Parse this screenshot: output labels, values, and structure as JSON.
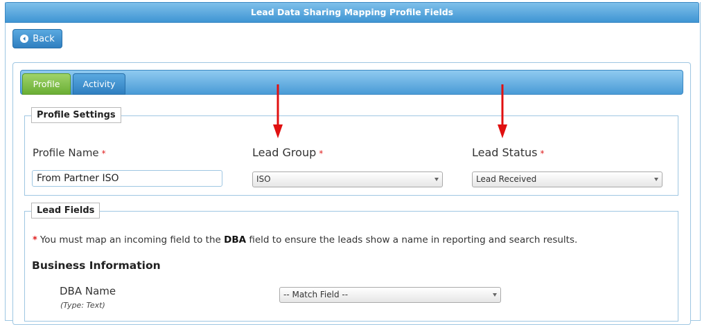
{
  "window": {
    "title": "Lead Data Sharing Mapping Profile Fields"
  },
  "toolbar": {
    "back_label": "Back"
  },
  "tabs": [
    {
      "label": "Profile",
      "active": true
    },
    {
      "label": "Activity",
      "active": false
    }
  ],
  "profile_settings": {
    "legend": "Profile Settings",
    "profile_name": {
      "label": "Profile Name",
      "required_mark": "*",
      "value": "From Partner ISO"
    },
    "lead_group": {
      "label": "Lead Group",
      "required_mark": "*",
      "selected": "ISO"
    },
    "lead_status": {
      "label": "Lead Status",
      "required_mark": "*",
      "selected": "Lead Received"
    }
  },
  "lead_fields": {
    "legend": "Lead Fields",
    "note": {
      "star": "*",
      "before": "You must map an incoming field to the",
      "bold": "DBA",
      "after": "field to ensure the leads show a name in reporting and search results."
    },
    "section_title": "Business Information",
    "fields": [
      {
        "label": "DBA Name",
        "type_hint": "(Type: Text)",
        "selected": "-- Match Field --"
      }
    ]
  },
  "colors": {
    "title_bar": "#3f95d3",
    "tab_active": "#6aae34",
    "tab_inactive": "#2f7fc0",
    "required": "#e02020",
    "annotation_arrow": "#e01010"
  }
}
